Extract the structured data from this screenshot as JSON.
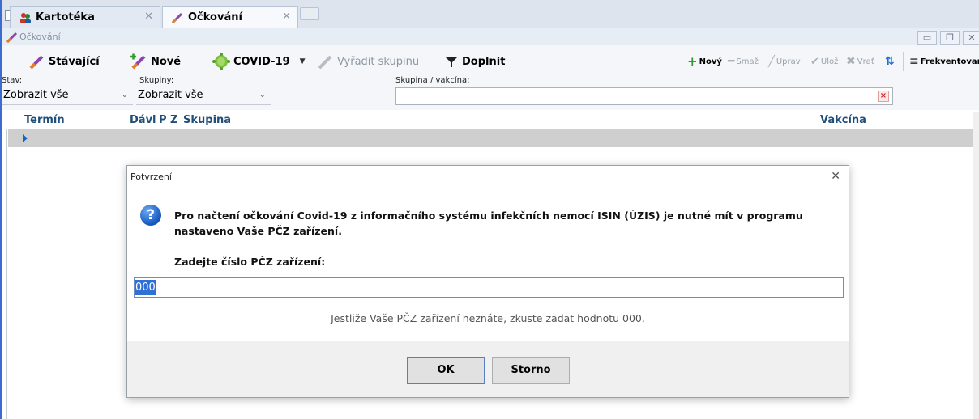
{
  "tabs": [
    {
      "label": "Kartotéka",
      "icon": "people-icon"
    },
    {
      "label": "Očkování",
      "icon": "syringe-icon"
    }
  ],
  "window": {
    "title": "Očkování"
  },
  "toolbar": {
    "stavajici": "Stávající",
    "nove": "Nové",
    "covid": "COVID-19",
    "vyradit": "Vyřadit skupinu",
    "doplnit": "Doplnit",
    "novy": "Nový",
    "smaz": "Smaž",
    "uprav": "Uprav",
    "uloz": "Ulož",
    "vrat": "Vrať",
    "frekventovane": "Frekventovan"
  },
  "filters": {
    "stav_label": "Stav:",
    "stav_value": "Zobrazit vše",
    "skupiny_label": "Skupiny:",
    "skupiny_value": "Zobrazit vše",
    "search_label": "Skupina / vakcína:",
    "search_value": ""
  },
  "grid": {
    "columns": {
      "termin": "Termín",
      "davka": "Dávl",
      "p": "P",
      "z": "Z",
      "skupina": "Skupina",
      "vakcina": "Vakcína"
    }
  },
  "dialog": {
    "title": "Potvrzení",
    "message": "Pro načtení očkování Covid-19 z informačního systému infekčních nemocí ISIN (ÚZIS) je nutné mít v programu nastaveno Vaše PČZ zařízení.",
    "prompt": "Zadejte číslo PČZ zařízení:",
    "input_value": "000",
    "hint": "Jestliže Vaše PČZ zařízení neznáte, zkuste zadat hodnotu 000.",
    "ok": "OK",
    "storno": "Storno"
  },
  "colors": {
    "accent": "#3c6ccf",
    "header_text": "#1f4e79",
    "selection": "#2f6fd6"
  }
}
